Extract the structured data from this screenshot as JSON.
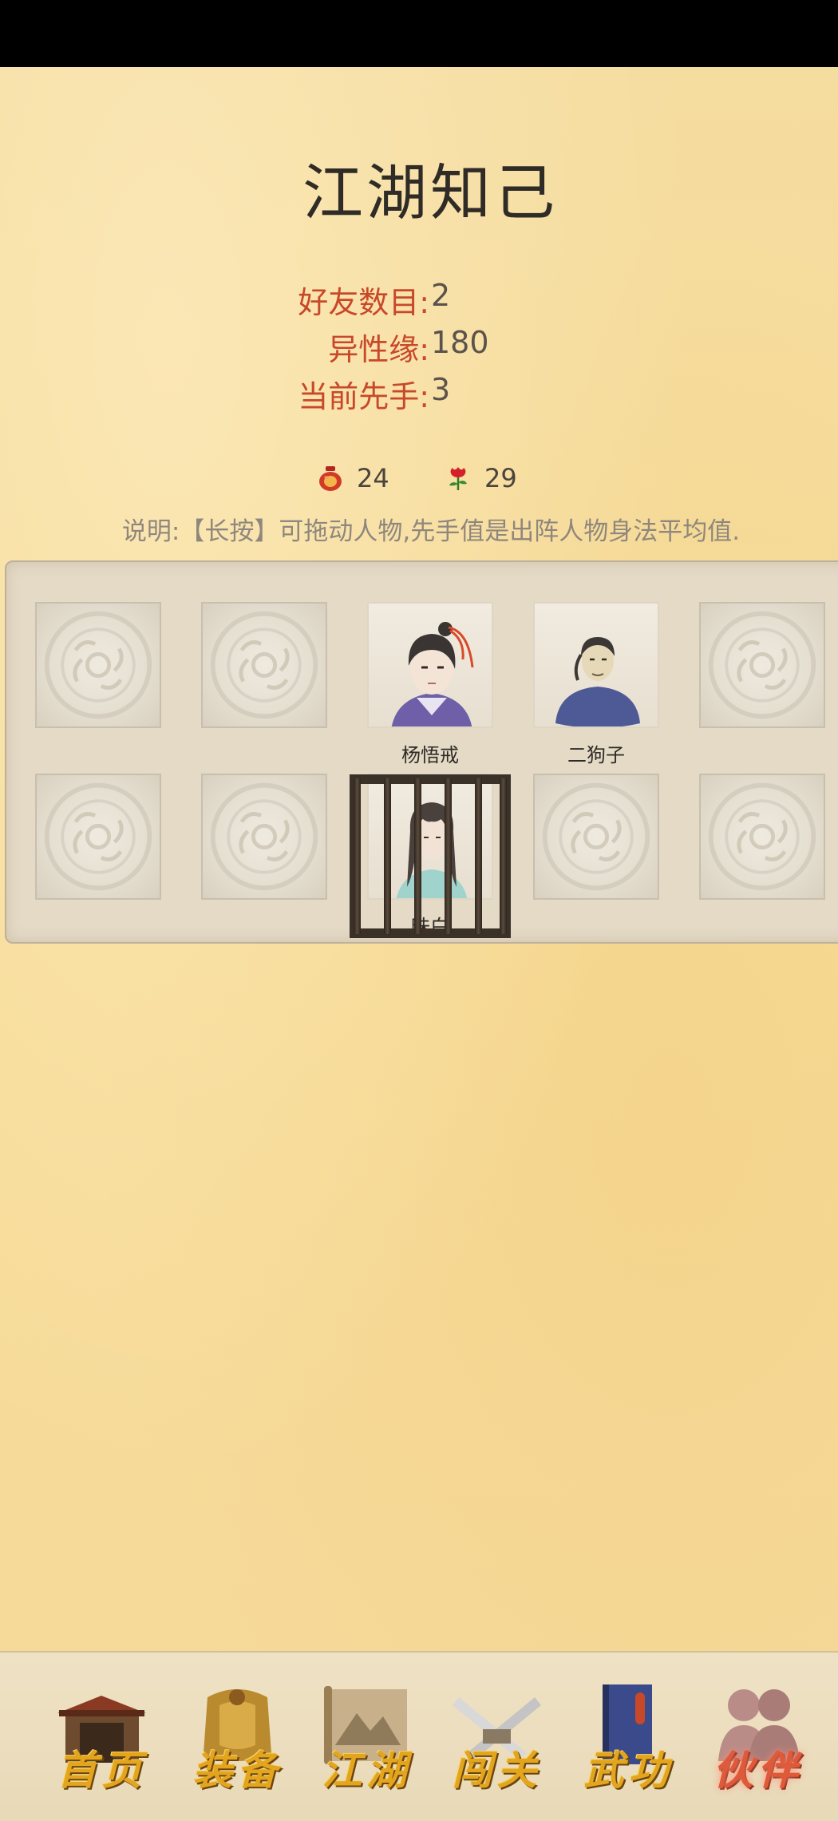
{
  "page_title": "江湖知己",
  "stats": [
    {
      "label": "好友数目:",
      "value": "2"
    },
    {
      "label": "异性缘:",
      "value": "180"
    },
    {
      "label": "当前先手:",
      "value": "3"
    }
  ],
  "resources": [
    {
      "icon": "jar-icon",
      "value": "24"
    },
    {
      "icon": "rose-icon",
      "value": "29"
    }
  ],
  "note": "说明:【长按】可拖动人物,先手值是出阵人物身法平均值.",
  "characters": {
    "yang": "杨悟戒",
    "ergou": "二狗子",
    "caged": "昧白"
  },
  "tabs": [
    {
      "label": "首页",
      "icon": "temple-icon"
    },
    {
      "label": "装备",
      "icon": "armor-icon"
    },
    {
      "label": "江湖",
      "icon": "scroll-map-icon"
    },
    {
      "label": "闯关",
      "icon": "crossed-swords-icon"
    },
    {
      "label": "武功",
      "icon": "book-icon"
    },
    {
      "label": "伙伴",
      "icon": "partners-icon",
      "active": true
    }
  ],
  "colors": {
    "accent_red": "#c8482a",
    "gold": "#e2a51d"
  }
}
